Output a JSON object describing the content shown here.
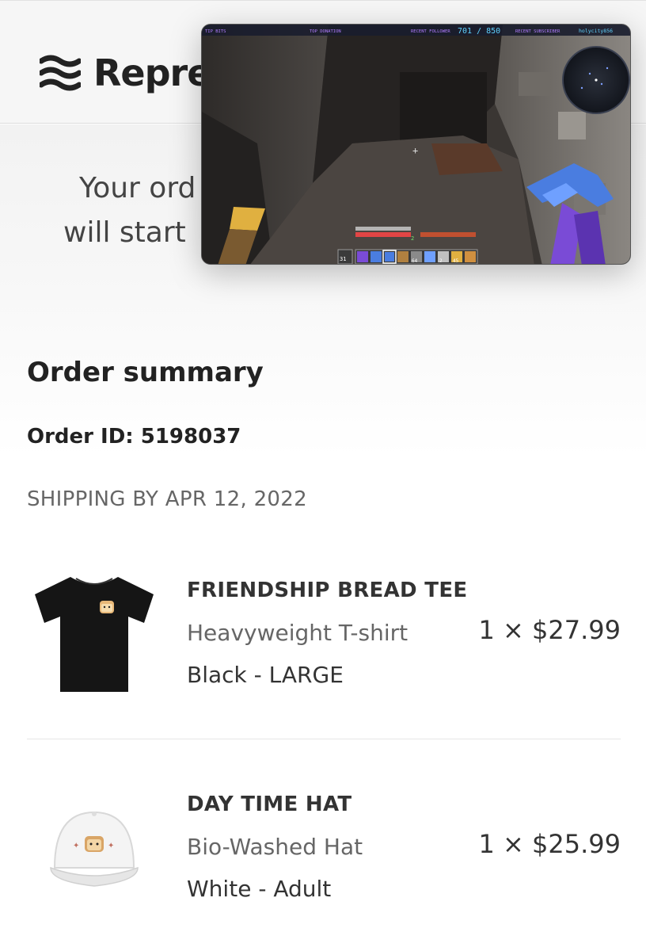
{
  "header": {
    "logo_text": "Repre",
    "logo_icon": "wave-lines-icon"
  },
  "confirmation": {
    "line1": "Your ord",
    "line2": "will start "
  },
  "video_overlay": {
    "hud_top_left": "TIP BITS",
    "hud_top_donation": "TOP DONATION",
    "hud_recent_follower": "RECENT FOLLOWER",
    "hud_counter": "701 / 850",
    "hud_recent_subscriber": "RECENT SUBSCRIBER",
    "hud_username": "holycity856",
    "hotbar_count_left": "31",
    "hotbar_count_a": "64",
    "hotbar_count_b": "2",
    "hotbar_count_c": "45",
    "xp_level": "2"
  },
  "summary": {
    "title": "Order summary",
    "order_id_label": "Order ID: 5198037",
    "shipping_label": "SHIPPING BY APR 12, 2022"
  },
  "items": [
    {
      "name": "FRIENDSHIP BREAD TEE",
      "type": "Heavyweight T-shirt",
      "variant": "Black - LARGE",
      "price": "1 × $27.99",
      "image_icon": "black-tshirt-icon"
    },
    {
      "name": "DAY TIME HAT",
      "type": "Bio-Washed Hat",
      "variant": "White - Adult",
      "price": "1 × $25.99",
      "image_icon": "white-cap-icon"
    }
  ],
  "colors": {
    "text_dark": "#222222",
    "text_muted": "#666666",
    "hud_cyan": "#5fd3ff",
    "hud_purple": "#b07cff"
  }
}
